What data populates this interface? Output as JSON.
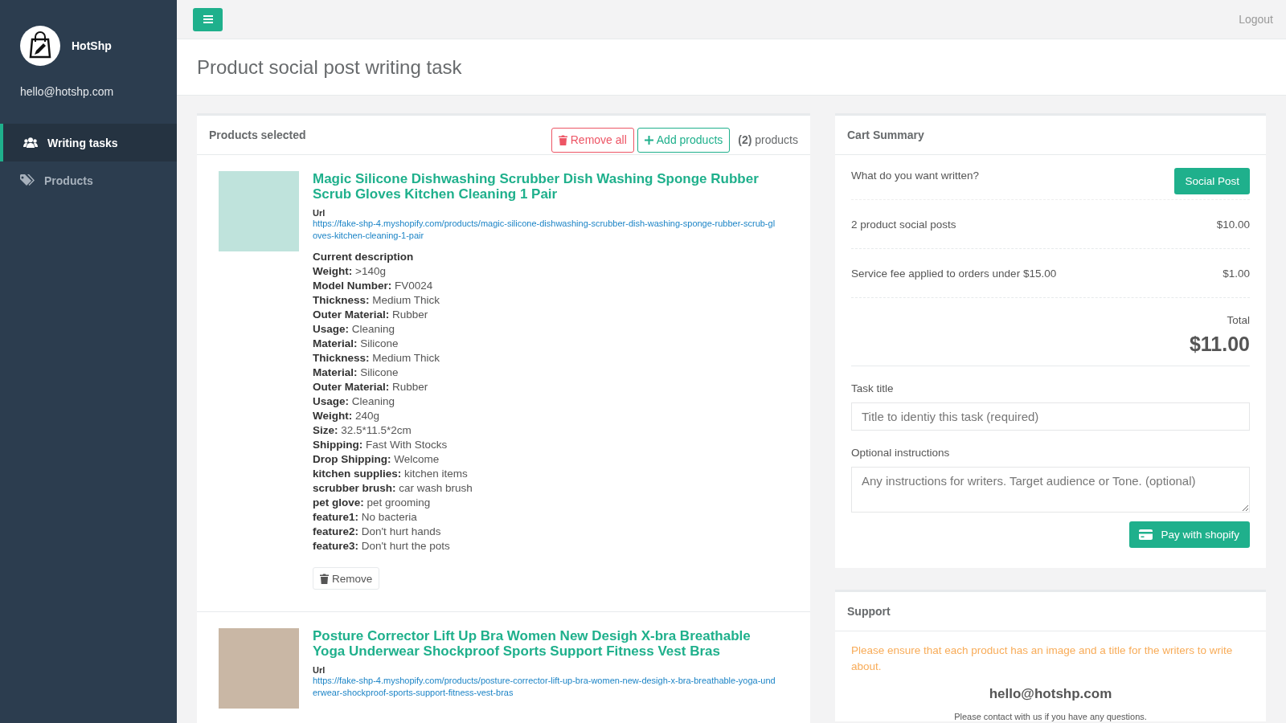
{
  "sidebar": {
    "brand": "HotShp",
    "email": "hello@hotshp.com",
    "items": [
      {
        "label": "Writing tasks",
        "selected": true
      },
      {
        "label": "Products",
        "selected": false
      }
    ]
  },
  "topbar": {
    "logout": "Logout"
  },
  "page_title": "Product social post writing task",
  "products_panel": {
    "title": "Products selected",
    "remove_all": "Remove all",
    "add_products": "Add products",
    "count": "**(2)** products",
    "products": [
      {
        "title": "Magic Silicone Dishwashing Scrubber Dish Washing Sponge Rubber Scrub Gloves Kitchen Cleaning 1 Pair",
        "url_label": "Url",
        "url": "https://fake-shp-4.myshopify.com/products/magic-silicone-dishwashing-scrubber-dish-washing-sponge-rubber-scrub-gloves-kitchen-cleaning-1-pair",
        "description_title": "Current description",
        "description": [
          "**Weight:** >140g",
          "**Model Number:** FV0024",
          "**Thickness:** Medium Thick",
          "**Outer Material:** Rubber",
          "**Usage:** Cleaning",
          "**Material:** Silicone",
          "**Thickness:** Medium Thick",
          "**Material:** Silicone",
          "**Outer Material:** Rubber",
          "**Usage:** Cleaning",
          "**Weight:** 240g",
          "**Size:** 32.5*11.5*2cm",
          "**Shipping:** Fast With Stocks",
          "**Drop Shipping:** Welcome",
          "**kitchen supplies:** kitchen items",
          "**scrubber brush:** car wash brush",
          "**pet glove:** pet grooming",
          "**feature1:** No bacteria",
          "**feature2:** Don't hurt hands",
          "**feature3:** Don't hurt the pots"
        ],
        "remove": "Remove"
      },
      {
        "title": "Posture Corrector Lift Up Bra Women New Desigh X-bra Breathable Yoga Underwear Shockproof Sports Support Fitness Vest Bras",
        "url_label": "Url",
        "url": "https://fake-shp-4.myshopify.com/products/posture-corrector-lift-up-bra-women-new-desigh-x-bra-breathable-yoga-underwear-shockproof-sports-support-fitness-vest-bras"
      }
    ]
  },
  "cart": {
    "title": "Cart Summary",
    "question": "What do you want written?",
    "type_button": "Social Post",
    "lines": [
      {
        "label": "2 product social posts",
        "amount": "$10.00"
      },
      {
        "label": "Service fee applied to orders under $15.00",
        "amount": "$1.00"
      }
    ],
    "total_label": "Total",
    "total": "$11.00",
    "task_title_label": "Task title",
    "task_title_placeholder": "Title to identiy this task (required)",
    "instructions_label": "Optional instructions",
    "instructions_placeholder": "Any instructions for writers. Target audience or Tone. (optional)",
    "pay_button": "Pay with shopify"
  },
  "support": {
    "title": "Support",
    "notice": "Please ensure that each product has an image and a title for the writers to write about.",
    "email": "hello@hotshp.com",
    "contact": "Please contact with us if you have any questions."
  }
}
